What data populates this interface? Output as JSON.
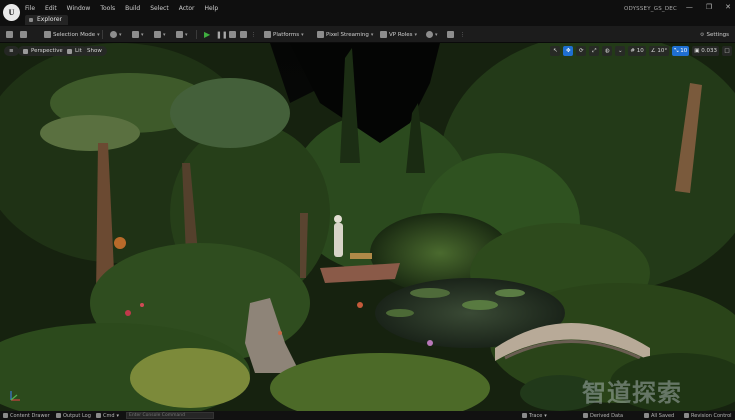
{
  "menu": {
    "items": [
      "File",
      "Edit",
      "Window",
      "Tools",
      "Build",
      "Select",
      "Actor",
      "Help"
    ]
  },
  "tab": {
    "label": "Explorer"
  },
  "project": {
    "name": "ODYSSEY_GS_DEC"
  },
  "window_controls": [
    "—",
    "❐",
    "✕"
  ],
  "toolbar": {
    "selection_mode": "Selection Mode",
    "platforms": "Platforms",
    "pixel_streaming": "Pixel Streaming",
    "vp_roles": "VP Roles",
    "settings": "Settings"
  },
  "viewport": {
    "perspective": "Perspective",
    "lit": "Lit",
    "show": "Show",
    "grid_snap": "10",
    "rotation_snap": "10°",
    "scale_snap": "10",
    "camera_speed": "0.033",
    "watermark": "智道探索",
    "icons": [
      "select-icon",
      "translate-icon",
      "rotate-icon",
      "scale-icon",
      "world-icon",
      "surface-snap-icon",
      "grid-icon",
      "rotate-snap-icon",
      "scale-snap-icon",
      "camera-speed-icon",
      "maximize-icon"
    ]
  },
  "statusbar": {
    "content_drawer": "Content Drawer",
    "output_log": "Output Log",
    "cmd": "Cmd",
    "cmd_placeholder": "Enter Console Command",
    "trace": "Trace",
    "derived_data": "Derived Data",
    "all_saved": "All Saved",
    "revision_control": "Revision Control"
  },
  "colors": {
    "accent": "#1f6fd1",
    "play": "#3fae3f",
    "background": "#151515"
  }
}
